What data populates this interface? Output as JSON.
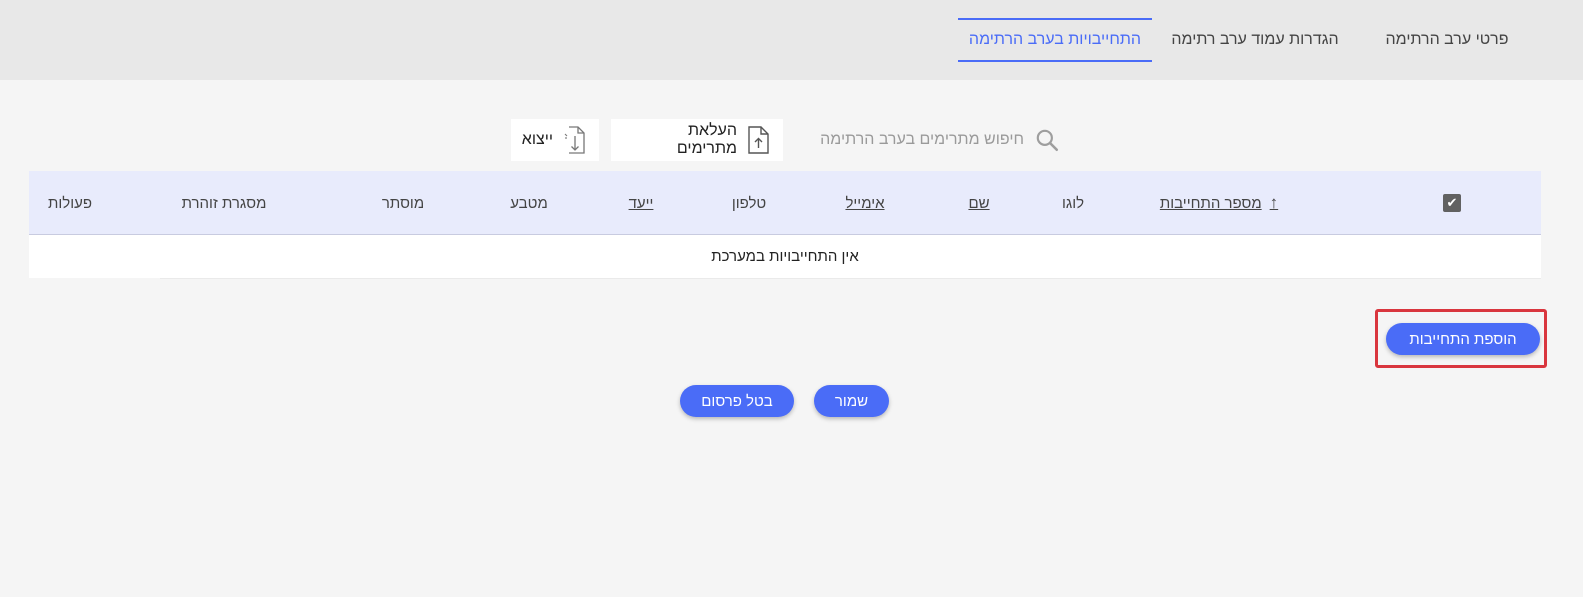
{
  "tabs": [
    {
      "label": "פרטי ערב הרתימה"
    },
    {
      "label": "הגדרות עמוד ערב רתימה"
    },
    {
      "label": "התחייבויות בערב הרתימה"
    }
  ],
  "toolbar": {
    "search_placeholder": "חיפוש מתרימים בערב הרתימה",
    "upload_label": "העלאת מתרימים",
    "export_label": "ייצוא"
  },
  "table": {
    "columns": {
      "commitment_number": "מספר התחייבות",
      "logo": "לוגו",
      "name": "שם",
      "email": "אימייל",
      "phone": "טלפון",
      "target": "ייעד",
      "currency": "מטבע",
      "hidden": "מוסתר",
      "golden_frame": "מסגרת זוהרת",
      "actions": "פעולות"
    },
    "sort_arrow": "↑",
    "empty_message": "אין התחייבויות במערכת"
  },
  "buttons": {
    "add_commitment": "הוספת התחייבות",
    "save": "שמור",
    "unpublish": "בטל פרסום"
  },
  "colors": {
    "accent": "#4a6cf7",
    "header_bg": "#e8ebfc",
    "highlight": "#d9363e"
  }
}
